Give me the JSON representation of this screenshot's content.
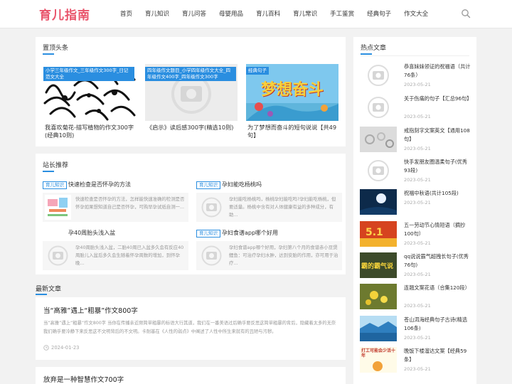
{
  "header": {
    "logo": "育儿指南",
    "nav": [
      "首页",
      "育儿知识",
      "育儿问答",
      "母婴用品",
      "育儿百科",
      "育儿常识",
      "手工鉴赏",
      "经典句子",
      "作文大全"
    ]
  },
  "top_section": {
    "title": "置顶头条",
    "cards": [
      {
        "tag": "小学三年级作文_三年级作文300字_日记范文大全",
        "title": "我喜欢菊花-描写植物的作文300字(经典10则)"
      },
      {
        "tag": "四年级作文题目_小学四年级作文大全_四年级作文400字_四年级作文300字",
        "title": "《启示》读后感300字(精选10则)"
      },
      {
        "tag": "经典句子",
        "title": "为了梦想而奋斗的短句说说【共49句】",
        "banner": "梦想奋斗"
      }
    ]
  },
  "recommend": {
    "title": "站长推荐",
    "items": [
      {
        "badge": "育儿知识",
        "title": "快速检查是否怀孕的方法",
        "desc": "快速检查是否怀孕的方法，怎样能快速准确的检测是否怀孕如果想知道自己是否怀孕，可购早孕试纸自测一..."
      },
      {
        "badge": "育儿知识",
        "title": "孕妇能吃杨桃吗",
        "desc": "孕妇能吃杨桃吗，杨桃孕妇能吃吗?孕妇能吃杨桃，但要适量。杨桃中含有对人体健康有益的多种成分，有助..."
      },
      {
        "badge": "",
        "title": "孕40周胎头浅入盆",
        "desc": "孕40周胎头浅入盆，二胎40周已入盆多久会有反应40周胎儿入盆后多久会生随着怀孕周数的增加，到怀孕晚..."
      },
      {
        "badge": "育儿知识",
        "title": "孕妇食谱app哪个好用",
        "desc": "孕妇食谱app哪个好用，孕妇第八个月的食谱赤小豆煲鲤鱼：可治疗孕妇水肿，达到安胎的作用，亦可用于治疗..."
      }
    ]
  },
  "latest": {
    "title": "最新文章",
    "articles": [
      {
        "title": "当“高雅”遇上“粗暴”作文800字",
        "desc": "当“高雅”遇上“粗暴”作文800字 当你在传播亲近频简单粗暴的标语大行其道，我们在一番美语过后确乎要反思这简单粗暴的背后，隐藏着太多的无奈我们确乎要冷静下来反思这不文明背后的不文明。卡耐基在《人性的弱点》中阐述了人性中所生来就有的丑陋与污秽。",
        "date": "2024-01-23"
      },
      {
        "title": "放弃是一种智慧作文700字"
      }
    ]
  },
  "hot": {
    "title": "热点文章",
    "items": [
      {
        "title": "恭喜妹妹领证的祝福语（共计76条）",
        "date": "2023-05-21",
        "thumb": "placeholder"
      },
      {
        "title": "关于伤痛的句子【汇总96句】",
        "date": "2023-05-21",
        "thumb": "placeholder"
      },
      {
        "title": "戒指刻字文案英文【通用108句】",
        "date": "2023-05-21",
        "thumb": "rings"
      },
      {
        "title": "快手发朋友圈温柔句子(优秀93段)",
        "date": "2023-05-21",
        "thumb": "placeholder"
      },
      {
        "title": "祝福中秋语(共计105段)",
        "date": "2023-05-21",
        "thumb": "night"
      },
      {
        "title": "五一劳动节心情短语（摘抄100句）",
        "date": "2023-05-21",
        "thumb": "labor"
      },
      {
        "title": "qq说说霸气超拽长句子(优秀76句)",
        "date": "2023-05-21",
        "thumb": "text",
        "thumb_text": "霸的霸气说"
      },
      {
        "title": "连翘文案花语（合集120段）",
        "date": "2023-05-21",
        "thumb": "flower"
      },
      {
        "title": "苍山洱海经典句子古诗(精选106条)",
        "date": "2023-05-21",
        "thumb": "lake"
      },
      {
        "title": "晚饭下楼溜达文案【经典59条】",
        "date": "2023-05-21",
        "thumb": "poster",
        "thumb_text": "打工可能会少活十年"
      }
    ]
  }
}
